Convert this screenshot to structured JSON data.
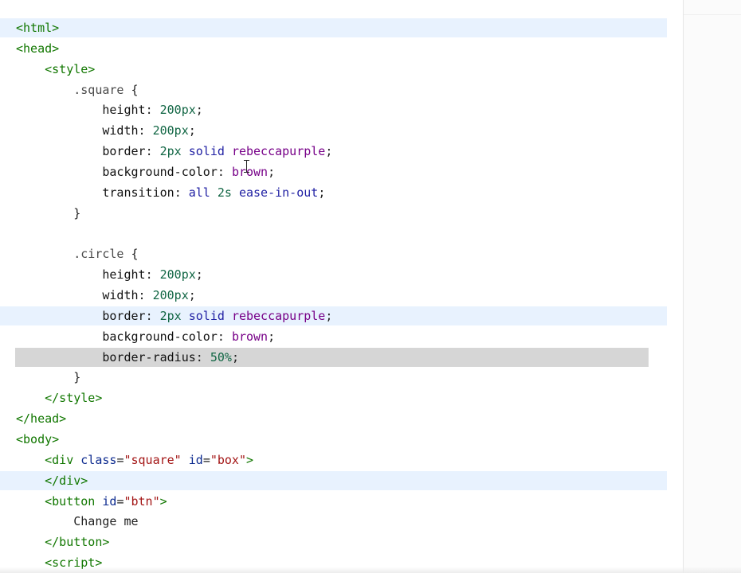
{
  "editor": {
    "lines": [
      {
        "id": "l1",
        "tokens": [
          {
            "t": "<html>",
            "c": "tag"
          }
        ]
      },
      {
        "id": "l2",
        "tokens": [
          {
            "t": "<head>",
            "c": "tag"
          }
        ]
      },
      {
        "id": "l3",
        "tokens": [
          {
            "t": "    "
          },
          {
            "t": "<style>",
            "c": "tag"
          }
        ]
      },
      {
        "id": "l4",
        "tokens": [
          {
            "t": "        "
          },
          {
            "t": ".square",
            "c": "sel"
          },
          {
            "t": " {",
            "c": "punc"
          }
        ]
      },
      {
        "id": "l5",
        "tokens": [
          {
            "t": "            "
          },
          {
            "t": "height",
            "c": "prop"
          },
          {
            "t": ": ",
            "c": "punc"
          },
          {
            "t": "200px",
            "c": "num"
          },
          {
            "t": ";",
            "c": "punc"
          }
        ]
      },
      {
        "id": "l6",
        "tokens": [
          {
            "t": "            "
          },
          {
            "t": "width",
            "c": "prop"
          },
          {
            "t": ": ",
            "c": "punc"
          },
          {
            "t": "200px",
            "c": "num"
          },
          {
            "t": ";",
            "c": "punc"
          }
        ]
      },
      {
        "id": "l7",
        "tokens": [
          {
            "t": "            "
          },
          {
            "t": "border",
            "c": "prop"
          },
          {
            "t": ": ",
            "c": "punc"
          },
          {
            "t": "2px",
            "c": "num"
          },
          {
            "t": " "
          },
          {
            "t": "solid",
            "c": "kw"
          },
          {
            "t": " "
          },
          {
            "t": "rebeccapurple",
            "c": "col"
          },
          {
            "t": ";",
            "c": "punc"
          }
        ]
      },
      {
        "id": "l8",
        "tokens": [
          {
            "t": "            "
          },
          {
            "t": "background-color",
            "c": "prop"
          },
          {
            "t": ": ",
            "c": "punc"
          },
          {
            "t": "brown",
            "c": "col"
          },
          {
            "t": ";",
            "c": "punc"
          }
        ]
      },
      {
        "id": "l9",
        "tokens": [
          {
            "t": "            "
          },
          {
            "t": "transition",
            "c": "prop"
          },
          {
            "t": ": ",
            "c": "punc"
          },
          {
            "t": "all",
            "c": "kw"
          },
          {
            "t": " "
          },
          {
            "t": "2s",
            "c": "num"
          },
          {
            "t": " "
          },
          {
            "t": "ease-in-out",
            "c": "kw"
          },
          {
            "t": ";",
            "c": "punc"
          }
        ]
      },
      {
        "id": "l10",
        "tokens": [
          {
            "t": "        "
          },
          {
            "t": "}",
            "c": "punc"
          }
        ]
      },
      {
        "id": "l11",
        "tokens": [
          {
            "t": ""
          }
        ]
      },
      {
        "id": "l12",
        "tokens": [
          {
            "t": "        "
          },
          {
            "t": ".circle",
            "c": "sel"
          },
          {
            "t": " {",
            "c": "punc"
          }
        ]
      },
      {
        "id": "l13",
        "tokens": [
          {
            "t": "            "
          },
          {
            "t": "height",
            "c": "prop"
          },
          {
            "t": ": ",
            "c": "punc"
          },
          {
            "t": "200px",
            "c": "num"
          },
          {
            "t": ";",
            "c": "punc"
          }
        ]
      },
      {
        "id": "l14",
        "tokens": [
          {
            "t": "            "
          },
          {
            "t": "width",
            "c": "prop"
          },
          {
            "t": ": ",
            "c": "punc"
          },
          {
            "t": "200px",
            "c": "num"
          },
          {
            "t": ";",
            "c": "punc"
          }
        ]
      },
      {
        "id": "l15",
        "tokens": [
          {
            "t": "            "
          },
          {
            "t": "border",
            "c": "prop"
          },
          {
            "t": ": ",
            "c": "punc"
          },
          {
            "t": "2px",
            "c": "num"
          },
          {
            "t": " "
          },
          {
            "t": "solid",
            "c": "kw"
          },
          {
            "t": " "
          },
          {
            "t": "rebeccapurple",
            "c": "col"
          },
          {
            "t": ";",
            "c": "punc"
          }
        ]
      },
      {
        "id": "l16",
        "tokens": [
          {
            "t": "            "
          },
          {
            "t": "background-color",
            "c": "prop"
          },
          {
            "t": ": ",
            "c": "punc"
          },
          {
            "t": "brown",
            "c": "col"
          },
          {
            "t": ";",
            "c": "punc"
          }
        ]
      },
      {
        "id": "l17",
        "tokens": [
          {
            "t": "            "
          },
          {
            "t": "border-radius",
            "c": "prop"
          },
          {
            "t": ": ",
            "c": "punc"
          },
          {
            "t": "50%",
            "c": "num"
          },
          {
            "t": ";",
            "c": "punc"
          }
        ]
      },
      {
        "id": "l18",
        "tokens": [
          {
            "t": "        "
          },
          {
            "t": "}",
            "c": "punc"
          }
        ]
      },
      {
        "id": "l19",
        "tokens": [
          {
            "t": "    "
          },
          {
            "t": "</style>",
            "c": "tag"
          }
        ]
      },
      {
        "id": "l20",
        "tokens": [
          {
            "t": "</head>",
            "c": "tag"
          }
        ]
      },
      {
        "id": "l21",
        "tokens": [
          {
            "t": "<body>",
            "c": "tag"
          }
        ]
      },
      {
        "id": "l22",
        "tokens": [
          {
            "t": "    "
          },
          {
            "t": "<div ",
            "c": "tag"
          },
          {
            "t": "class",
            "c": "attr"
          },
          {
            "t": "=",
            "c": "punc"
          },
          {
            "t": "\"square\"",
            "c": "str"
          },
          {
            "t": " "
          },
          {
            "t": "id",
            "c": "attr"
          },
          {
            "t": "=",
            "c": "punc"
          },
          {
            "t": "\"box\"",
            "c": "str"
          },
          {
            "t": ">",
            "c": "tag"
          }
        ]
      },
      {
        "id": "l23",
        "tokens": [
          {
            "t": "    "
          },
          {
            "t": "</div>",
            "c": "tag"
          }
        ]
      },
      {
        "id": "l24",
        "tokens": [
          {
            "t": "    "
          },
          {
            "t": "<button ",
            "c": "tag"
          },
          {
            "t": "id",
            "c": "attr"
          },
          {
            "t": "=",
            "c": "punc"
          },
          {
            "t": "\"btn\"",
            "c": "str"
          },
          {
            "t": ">",
            "c": "tag"
          }
        ]
      },
      {
        "id": "l25",
        "tokens": [
          {
            "t": "        "
          },
          {
            "t": "Change me",
            "c": "text"
          }
        ]
      },
      {
        "id": "l26",
        "tokens": [
          {
            "t": "    "
          },
          {
            "t": "</button>",
            "c": "tag"
          }
        ]
      },
      {
        "id": "l27",
        "tokens": [
          {
            "t": "    "
          },
          {
            "t": "<script>",
            "c": "tag"
          }
        ]
      }
    ],
    "highlighted_lines": [
      "l1",
      "l15",
      "l23"
    ],
    "selected_line": "l17",
    "colors": {
      "tag": "#117700",
      "attr": "#0c2a8f",
      "string": "#a31515",
      "number": "#116644",
      "keyword": "#1f1fa3",
      "color_value": "#770088",
      "active_line_bg": "#e8f2fe",
      "selection_bg": "#d6d6d6"
    },
    "cursor_icon": "text-cursor-icon"
  }
}
